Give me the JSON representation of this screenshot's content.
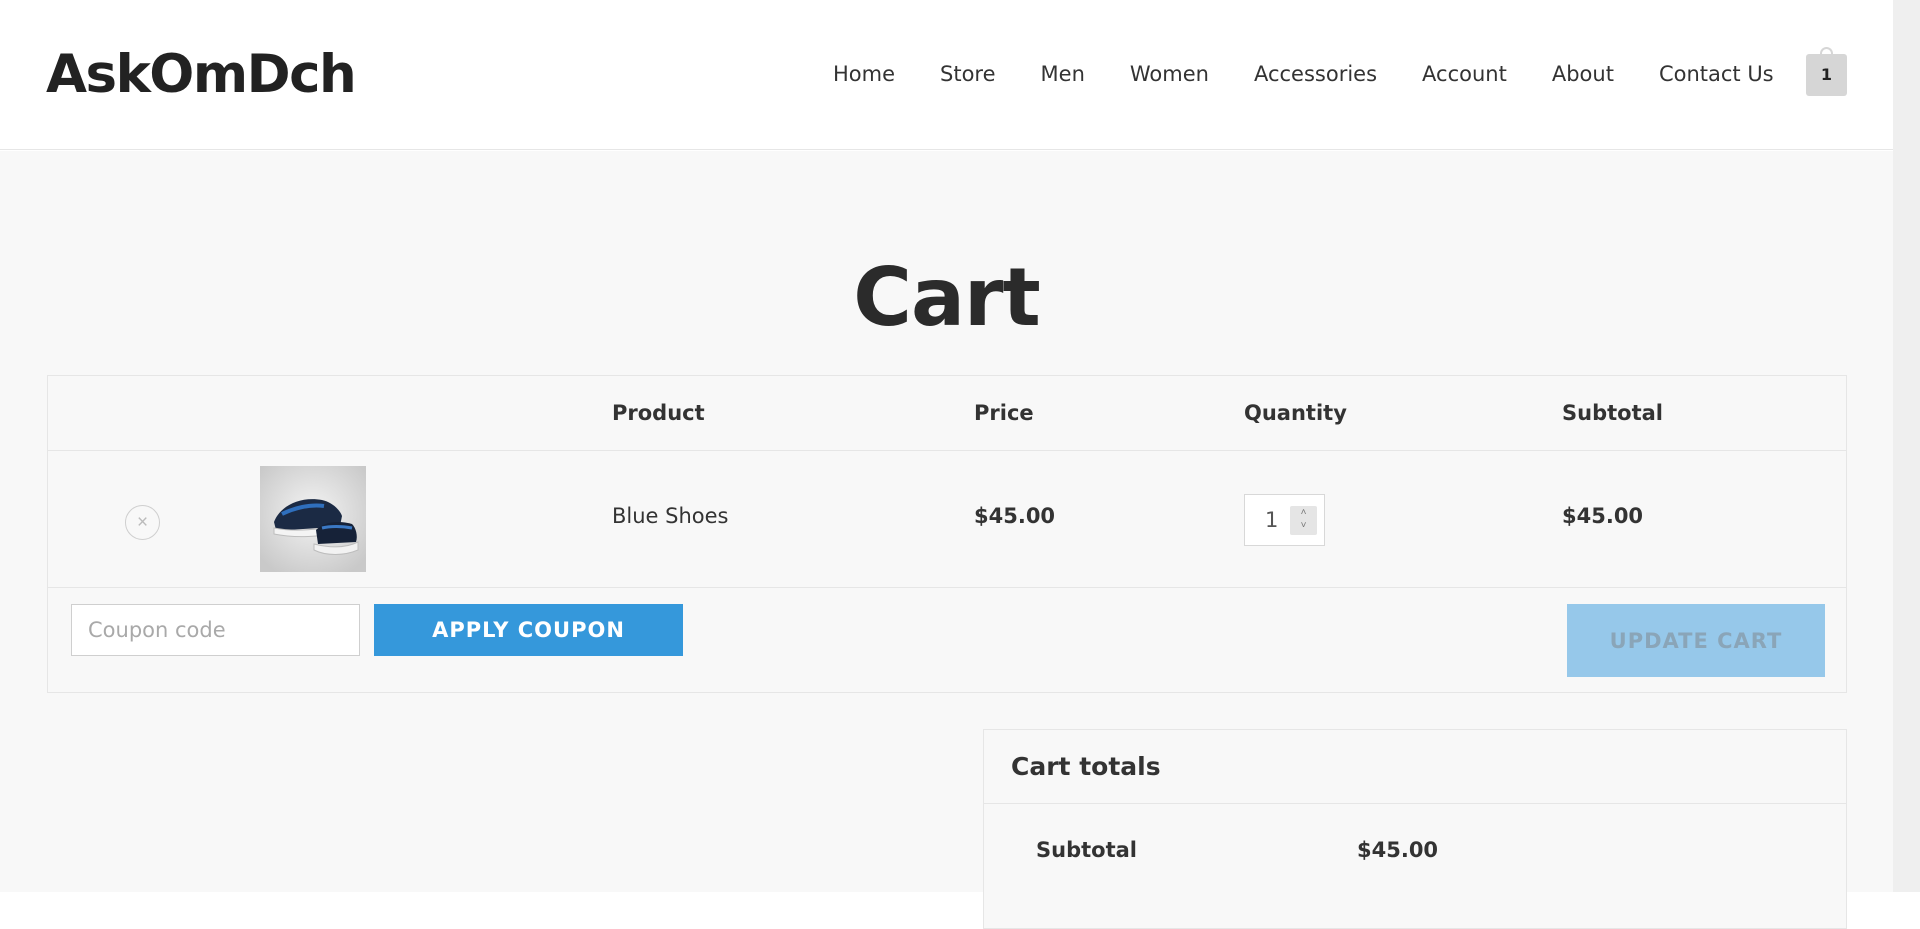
{
  "site": {
    "logo": "AskOmDch"
  },
  "nav": {
    "items": [
      {
        "label": "Home"
      },
      {
        "label": "Store"
      },
      {
        "label": "Men"
      },
      {
        "label": "Women"
      },
      {
        "label": "Accessories"
      },
      {
        "label": "Account"
      },
      {
        "label": "About"
      },
      {
        "label": "Contact Us"
      }
    ],
    "cart_count": "1"
  },
  "page": {
    "title": "Cart"
  },
  "cart_table": {
    "headers": {
      "product": "Product",
      "price": "Price",
      "quantity": "Quantity",
      "subtotal": "Subtotal"
    },
    "items": [
      {
        "remove_icon": "×",
        "product_name": "Blue Shoes",
        "price": "$45.00",
        "quantity": "1",
        "subtotal": "$45.00",
        "thumbnail_icon": "shoe-image"
      }
    ]
  },
  "actions": {
    "coupon_placeholder": "Coupon code",
    "apply_coupon_label": "APPLY COUPON",
    "update_cart_label": "UPDATE CART"
  },
  "totals": {
    "title": "Cart totals",
    "rows": [
      {
        "label": "Subtotal",
        "value": "$45.00"
      }
    ]
  },
  "colors": {
    "accent": "#3598db",
    "accent_disabled": "#96c8ea",
    "page_bg": "#f8f8f8",
    "header_bg": "#ffffff"
  }
}
